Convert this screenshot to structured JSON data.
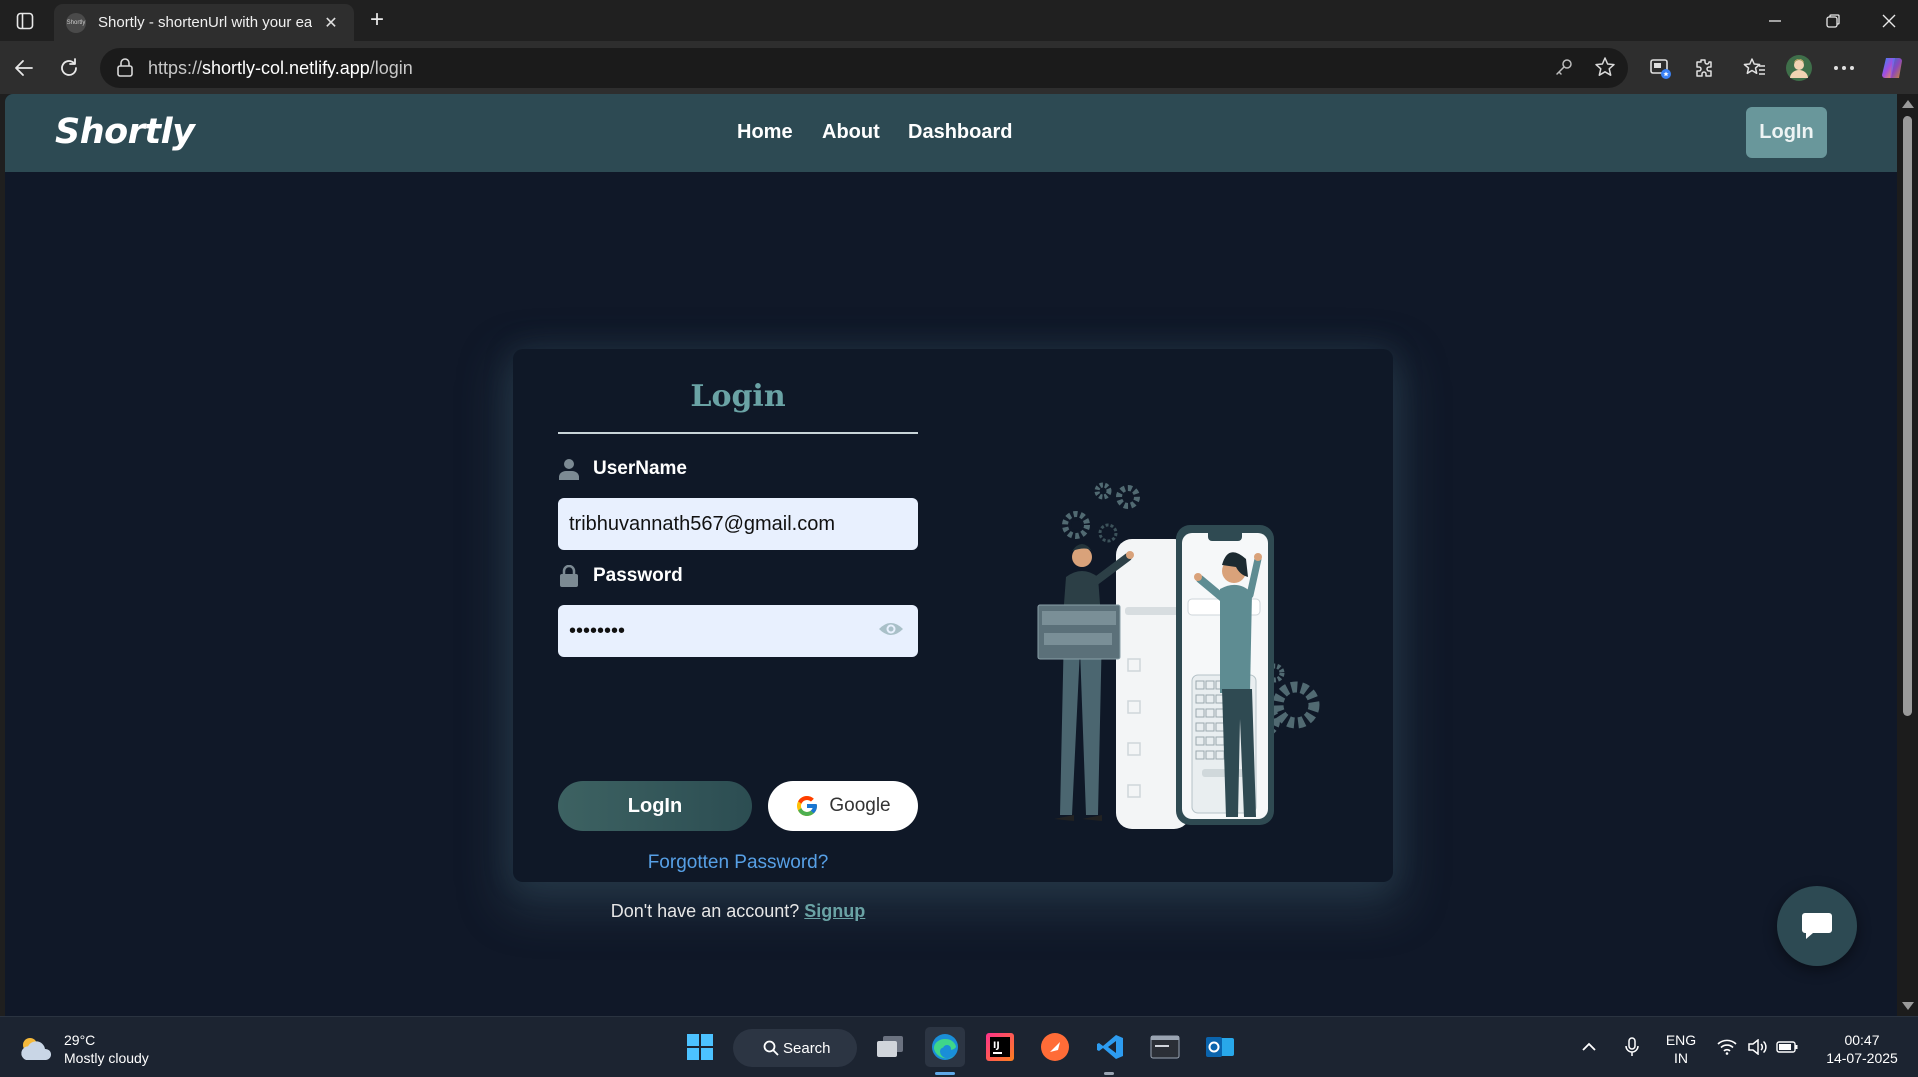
{
  "browser": {
    "tab_title": "Shortly - shortenUrl with your eas",
    "tab_favicon_text": "Shortly",
    "url_prefix": "https://",
    "url_host": "shortly-col.netlify.app",
    "url_path": "/login"
  },
  "site": {
    "brand": "Shortly",
    "nav": [
      "Home",
      "About",
      "Dashboard"
    ],
    "nav_login": "LogIn"
  },
  "login_card": {
    "title": "Login",
    "username_label": "UserName",
    "username_value": "tribhuvannath567@gmail.com",
    "password_label": "Password",
    "password_value": "••••••••",
    "login_button": "LogIn",
    "google_button": "Google",
    "forgot_link": "Forgotten Password?",
    "signup_prompt": "Don't have an account?",
    "signup_link": "Signup"
  },
  "taskbar": {
    "weather_temp": "29°C",
    "weather_desc": "Mostly cloudy",
    "search_label": "Search",
    "lang_line1": "ENG",
    "lang_line2": "IN",
    "time": "00:47",
    "date": "14-07-2025"
  },
  "colors": {
    "page_bg": "#101828",
    "navbar_bg": "#2d4a53",
    "accent_teal": "#6aa3a5",
    "link_blue": "#57a0e6"
  }
}
